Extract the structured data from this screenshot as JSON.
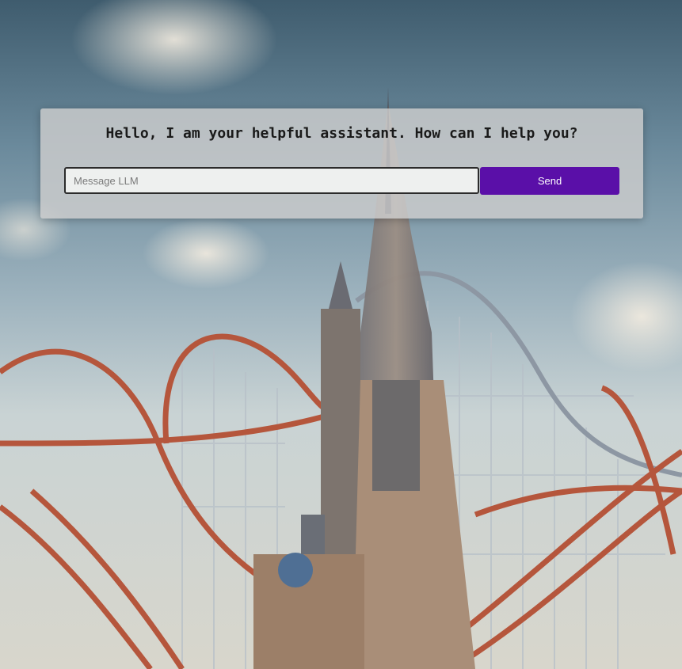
{
  "chat": {
    "greeting": "Hello, I am your helpful assistant. How can I help you?",
    "input_placeholder": "Message LLM",
    "input_value": "",
    "send_label": "Send"
  },
  "colors": {
    "send_button": "#5a0fa8",
    "panel": "#cdcdcd"
  },
  "background": {
    "icon": "roller-coaster-castle-image"
  }
}
